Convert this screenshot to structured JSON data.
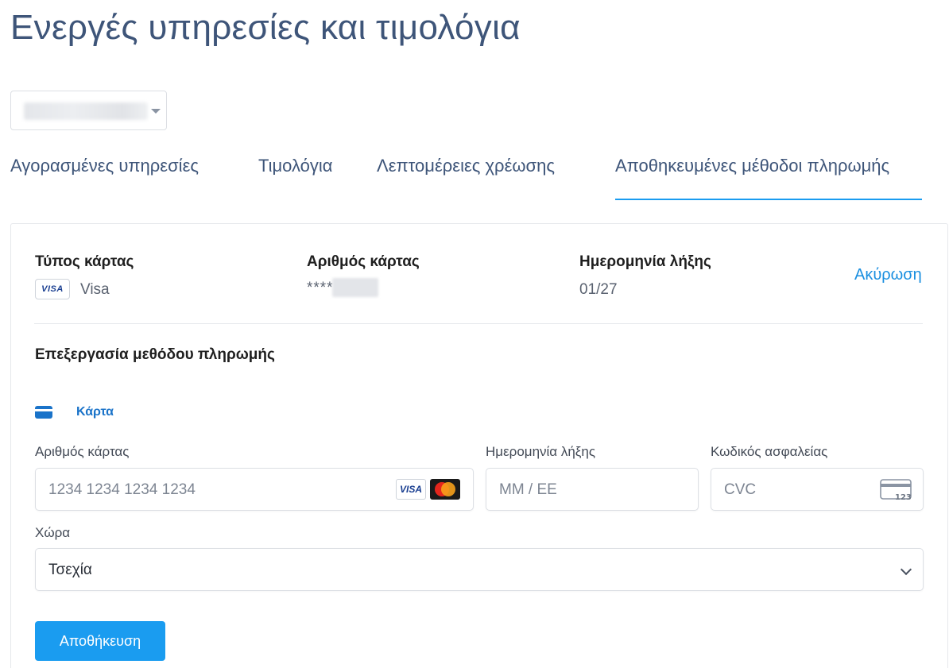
{
  "page_title": "Ενεργές υπηρεσίες και τιμολόγια",
  "tabs": [
    {
      "label": "Αγορασμένες υπηρεσίες",
      "active": false
    },
    {
      "label": "Τιμολόγια",
      "active": false
    },
    {
      "label": "Λεπτομέρειες χρέωσης",
      "active": false
    },
    {
      "label": "Αποθηκευμένες μέθοδοι πληρωμής",
      "active": true
    }
  ],
  "saved_card": {
    "type_label": "Τύπος κάρτας",
    "type_badge": "VISA",
    "type_value": "Visa",
    "number_label": "Αριθμός κάρτας",
    "number_value": "****",
    "expiry_label": "Ημερομηνία λήξης",
    "expiry_value": "01/27",
    "cancel_link": "Ακύρωση"
  },
  "edit": {
    "title": "Επεξεργασία μεθόδου πληρωμής",
    "method_tab": "Κάρτα",
    "card_number_label": "Αριθμός κάρτας",
    "card_number_placeholder": "1234 1234 1234 1234",
    "expiry_label": "Ημερομηνία λήξης",
    "expiry_placeholder": "MM / ΕΕ",
    "cvc_label": "Κωδικός ασφαλείας",
    "cvc_placeholder": "CVC",
    "cvc_icon_text": "123",
    "country_label": "Χώρα",
    "country_value": "Τσεχία",
    "brand_visa": "VISA",
    "save_button": "Αποθήκευση"
  },
  "colors": {
    "title": "#3e5579",
    "accent": "#1a9cf0",
    "link": "#1a8fe0",
    "card_tab": "#1a73c9"
  },
  "icons": [
    "chevron-down-icon",
    "visa-icon",
    "mastercard-icon",
    "card-icon",
    "cvc-icon"
  ]
}
